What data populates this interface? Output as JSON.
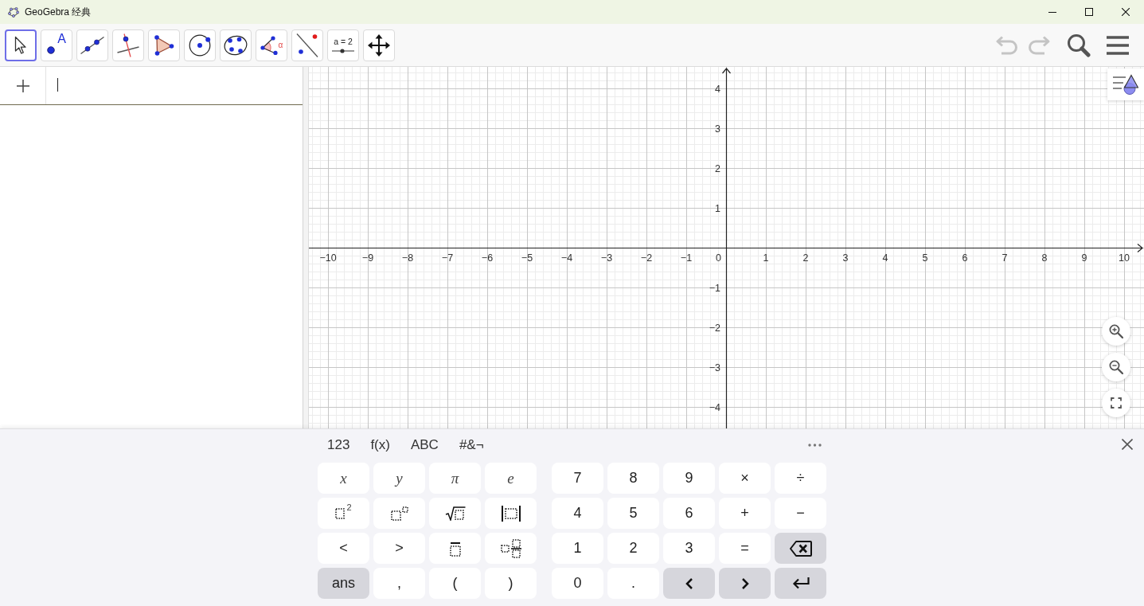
{
  "window": {
    "title": "GeoGebra 经典"
  },
  "toolbar": {
    "tools": [
      {
        "kind": "move",
        "selected": true
      },
      {
        "kind": "point",
        "label": "A",
        "selected": false
      },
      {
        "kind": "line",
        "selected": false
      },
      {
        "kind": "perpendicular",
        "selected": false
      },
      {
        "kind": "polygon",
        "selected": false
      },
      {
        "kind": "circle",
        "selected": false
      },
      {
        "kind": "conic",
        "selected": false
      },
      {
        "kind": "angle",
        "label": "α",
        "selected": false
      },
      {
        "kind": "reflect",
        "selected": false
      },
      {
        "kind": "slider",
        "label": "a = 2",
        "selected": false
      },
      {
        "kind": "pan",
        "selected": false
      }
    ],
    "actions": [
      {
        "kind": "undo",
        "disabled": true
      },
      {
        "kind": "redo",
        "disabled": true
      },
      {
        "kind": "search",
        "disabled": false
      },
      {
        "kind": "menu",
        "disabled": false
      }
    ]
  },
  "algebra": {
    "input": {
      "focused": true
    }
  },
  "graphics": {
    "x_labels": [
      "−10",
      "−9",
      "−8",
      "−7",
      "−6",
      "−5",
      "−4",
      "−3",
      "−2",
      "−1",
      "0",
      "1",
      "2",
      "3",
      "4",
      "5",
      "6",
      "7",
      "8",
      "9",
      "10"
    ],
    "y_labels": [
      "4",
      "3",
      "2",
      "1",
      "−1",
      "−2",
      "−3",
      "−4"
    ]
  },
  "keyboard": {
    "tabs": [
      {
        "label": "123"
      },
      {
        "label": "f(x)"
      },
      {
        "label": "ABC"
      },
      {
        "label": "#&¬"
      }
    ],
    "groups": [
      {
        "rows": [
          [
            {
              "kind": "math",
              "label": "x"
            },
            {
              "kind": "math",
              "label": "y"
            },
            {
              "kind": "math",
              "label": "π"
            },
            {
              "kind": "math",
              "label": "e"
            }
          ],
          [
            {
              "kind": "squared",
              "label": "2"
            },
            {
              "kind": "power"
            },
            {
              "kind": "sqrt"
            },
            {
              "kind": "abs"
            }
          ],
          [
            {
              "kind": "text",
              "label": "<"
            },
            {
              "kind": "text",
              "label": ">"
            },
            {
              "kind": "overline"
            },
            {
              "kind": "mixed"
            }
          ],
          [
            {
              "kind": "command",
              "label": "ans"
            },
            {
              "kind": "text",
              "label": ","
            },
            {
              "kind": "text",
              "label": "("
            },
            {
              "kind": "text",
              "label": ")"
            }
          ]
        ]
      },
      {
        "rows": [
          [
            {
              "kind": "text",
              "label": "7"
            },
            {
              "kind": "text",
              "label": "8"
            },
            {
              "kind": "text",
              "label": "9"
            },
            {
              "kind": "text",
              "label": "×"
            },
            {
              "kind": "text",
              "label": "÷"
            }
          ],
          [
            {
              "kind": "text",
              "label": "4"
            },
            {
              "kind": "text",
              "label": "5"
            },
            {
              "kind": "text",
              "label": "6"
            },
            {
              "kind": "text",
              "label": "+"
            },
            {
              "kind": "text",
              "label": "−"
            }
          ],
          [
            {
              "kind": "text",
              "label": "1"
            },
            {
              "kind": "text",
              "label": "2"
            },
            {
              "kind": "text",
              "label": "3"
            },
            {
              "kind": "text",
              "label": "="
            },
            {
              "kind": "backspace"
            }
          ],
          [
            {
              "kind": "text",
              "label": "0"
            },
            {
              "kind": "text",
              "label": "."
            },
            {
              "kind": "left"
            },
            {
              "kind": "right"
            },
            {
              "kind": "enter"
            }
          ]
        ]
      }
    ]
  }
}
